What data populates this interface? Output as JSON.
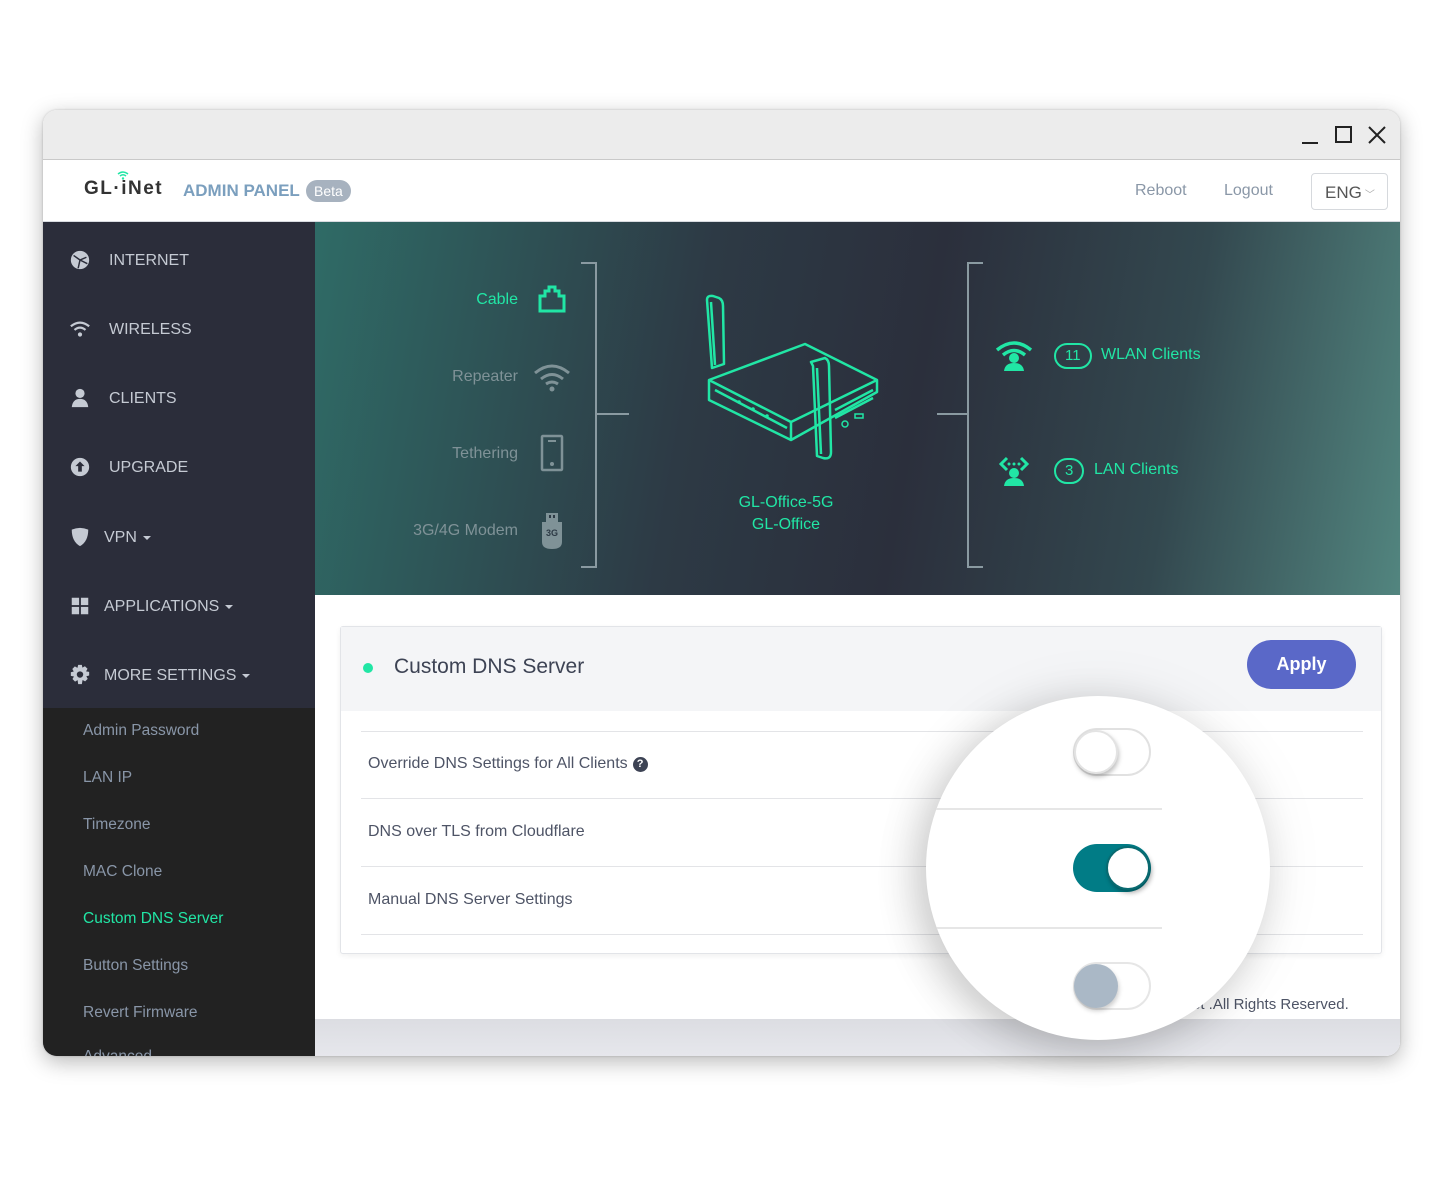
{
  "window": {
    "controls": {
      "minimize": "minimize-icon",
      "maximize": "maximize-icon",
      "close": "close-icon"
    }
  },
  "header": {
    "logo": "GL·iNet",
    "title": "ADMIN PANEL",
    "badge": "Beta",
    "links": {
      "reboot": "Reboot",
      "logout": "Logout"
    },
    "language": {
      "selected": "ENG",
      "icon": "chevron-down-icon"
    }
  },
  "sidebar": {
    "items": [
      {
        "label": "INTERNET",
        "icon": "globe-icon"
      },
      {
        "label": "WIRELESS",
        "icon": "wifi-icon"
      },
      {
        "label": "CLIENTS",
        "icon": "user-icon"
      },
      {
        "label": "UPGRADE",
        "icon": "upload-circle-icon"
      },
      {
        "label": "VPN",
        "icon": "shield-icon",
        "has_dropdown": true
      },
      {
        "label": "APPLICATIONS",
        "icon": "grid-icon",
        "has_dropdown": true
      },
      {
        "label": "MORE SETTINGS",
        "icon": "gear-icon",
        "has_dropdown": true,
        "expanded": true
      }
    ],
    "submenu": [
      {
        "label": "Admin Password"
      },
      {
        "label": "LAN IP"
      },
      {
        "label": "Timezone"
      },
      {
        "label": "MAC Clone"
      },
      {
        "label": "Custom DNS Server",
        "active": true
      },
      {
        "label": "Button Settings"
      },
      {
        "label": "Revert Firmware"
      },
      {
        "label": "Advanced"
      }
    ]
  },
  "banner": {
    "sources": [
      {
        "label": "Cable",
        "icon": "ethernet-port-icon",
        "active": true
      },
      {
        "label": "Repeater",
        "icon": "wifi-icon",
        "active": false
      },
      {
        "label": "Tethering",
        "icon": "phone-icon",
        "active": false
      },
      {
        "label": "3G/4G Modem",
        "icon": "usb-modem-icon",
        "active": false,
        "icon_text": "3G"
      }
    ],
    "device": {
      "ssid_5g": "GL-Office-5G",
      "ssid": "GL-Office",
      "icon": "router-icon"
    },
    "clients": [
      {
        "count": "11",
        "label": "WLAN Clients",
        "icon": "wireless-client-icon"
      },
      {
        "count": "3",
        "label": "LAN Clients",
        "icon": "lan-client-icon"
      }
    ],
    "accent": "#21e6a5"
  },
  "dns_card": {
    "title": "Custom DNS Server",
    "apply_label": "Apply",
    "settings": [
      {
        "label": "Override DNS Settings for All Clients",
        "help": "?",
        "state": "off"
      },
      {
        "label": "DNS over TLS from Cloudflare",
        "state": "on"
      },
      {
        "label": "Manual DNS Server Settings",
        "state": "disabled"
      }
    ]
  },
  "footer": {
    "copyright": "et .All Rights Reserved."
  },
  "colors": {
    "accent": "#21e6a5",
    "apply": "#5a68c8",
    "toggle_on": "#017c86",
    "sidebar": "#2b2d3a",
    "submenu": "#222222"
  }
}
